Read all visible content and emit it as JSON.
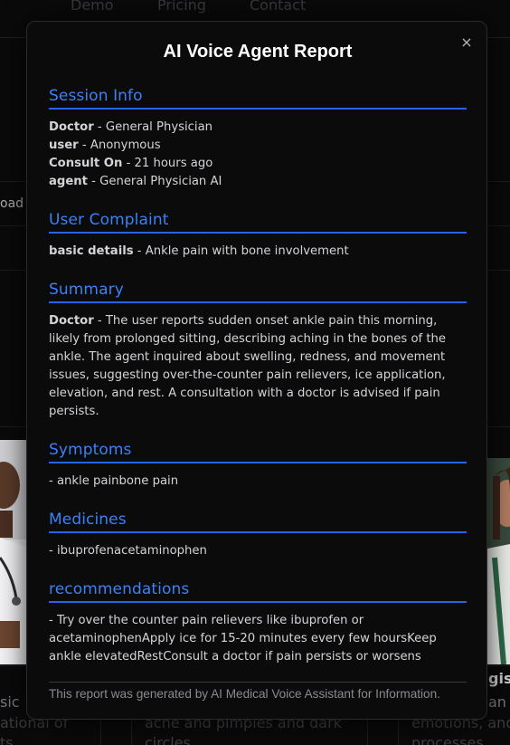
{
  "background": {
    "nav": [
      "Demo",
      "Pricing",
      "Contact"
    ],
    "fragment_left": "oad",
    "card_texts": {
      "left": "sic",
      "left2": "ational of",
      "left3": "ts",
      "middle": "acne and pimples and dark",
      "middle2": "circles",
      "right_title": "gis",
      "right": "an",
      "right2": "emotions, and",
      "right3": "processes"
    }
  },
  "modal": {
    "title": "AI Voice Agent Report",
    "close_label": "×",
    "session": {
      "heading": "Session Info",
      "rows": [
        {
          "key": "Doctor",
          "value": " - General Physician"
        },
        {
          "key": "user",
          "value": " - Anonymous"
        },
        {
          "key": "Consult On",
          "value": " - 21 hours ago"
        },
        {
          "key": "agent",
          "value": " - General Physician AI"
        }
      ]
    },
    "complaint": {
      "heading": "User Complaint",
      "key": "basic details",
      "value": " - Ankle pain with bone involvement"
    },
    "summary": {
      "heading": "Summary",
      "key": "Doctor",
      "value": " - The user reports sudden onset ankle pain this morning, likely from prolonged sitting, describing aching in the bones of the ankle. The agent inquired about swelling, redness, and movement issues, suggesting over-the-counter pain relievers, ice application, elevation, and rest. A consultation with a doctor is advised if pain persists."
    },
    "symptoms": {
      "heading": "Symptoms",
      "text": "- ankle painbone pain"
    },
    "medicines": {
      "heading": "Medicines",
      "text": "- ibuprofenacetaminophen"
    },
    "recommendations": {
      "heading": "recommendations",
      "text": "- Try over the counter pain relievers like ibuprofen or acetaminophenApply ice for 15-20 minutes every few hoursKeep ankle elevatedRestConsult a doctor if pain persists or worsens"
    },
    "footer": "This report was generated by AI Medical Voice Assistant for Information."
  },
  "colors": {
    "accent": "#3b82f6",
    "divider": "#2563eb",
    "modal_bg": "#0b0b0c",
    "page_bg": "#0a0a0b"
  }
}
